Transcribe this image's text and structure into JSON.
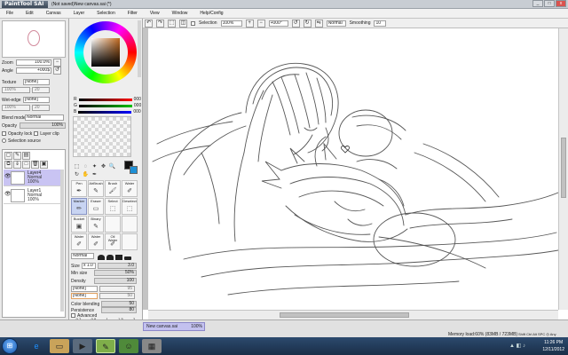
{
  "window": {
    "logo": "PaintTool SAI",
    "title": "(Not saved)New canvas.sai (*)",
    "min": "_",
    "max": "□",
    "close": "x"
  },
  "menu": [
    "File",
    "Edit",
    "Canvas",
    "Layer",
    "Selection",
    "Filter",
    "View",
    "Window",
    "Help/Config"
  ],
  "navigator": {
    "zoom_label": "Zoom",
    "zoom_value": "100.0%",
    "angle_label": "Angle",
    "angle_value": "+000$"
  },
  "texture": {
    "label": "Texture",
    "value": "[None]",
    "scale": "100%",
    "strength": "20"
  },
  "wetedge": {
    "label": "Wet-edge",
    "value": "[None]",
    "scale": "100%",
    "strength": "20"
  },
  "layer_props": {
    "blend_label": "Blend mode",
    "blend_value": "Normal",
    "opacity_label": "Opacity",
    "opacity_value": "100%",
    "opacity_lock": "Opacity lock",
    "layer_clip": "Layer clip",
    "selection_source": "Selection source"
  },
  "layers": [
    {
      "name": "Layer4",
      "mode": "Normal",
      "opacity": "100%"
    },
    {
      "name": "Layer1",
      "mode": "Normal",
      "opacity": "100%"
    }
  ],
  "rgb": {
    "r_label": "R",
    "g_label": "G",
    "b_label": "B",
    "r": "000",
    "g": "000",
    "b": "000"
  },
  "brushes": [
    {
      "label": "Pen",
      "icon": "✒"
    },
    {
      "label": "AirBrush",
      "icon": "✎"
    },
    {
      "label": "Brush",
      "icon": "🖌"
    },
    {
      "label": "Water",
      "icon": "✐"
    },
    {
      "label": "Marker",
      "icon": "✏"
    },
    {
      "label": "Eraser",
      "icon": "▭"
    },
    {
      "label": "Select",
      "icon": "⬚"
    },
    {
      "label": "Deselect",
      "icon": "⬚"
    },
    {
      "label": "Bucket",
      "icon": "▣"
    },
    {
      "label": "Binary",
      "icon": "✎"
    },
    {
      "label": "",
      "icon": ""
    },
    {
      "label": "",
      "icon": ""
    },
    {
      "label": "Water",
      "icon": "✐"
    },
    {
      "label": "Water",
      "icon": "✐"
    },
    {
      "label": "Oil Water",
      "icon": "✐"
    },
    {
      "label": "",
      "icon": ""
    }
  ],
  "brush_settings": {
    "mode": "Normal",
    "size_label": "Size",
    "size_mult": "x 1.0",
    "size_value": "3.0",
    "minsize_label": "Min size",
    "minsize_value": "50%",
    "density_label": "Density",
    "density_value": "100",
    "texture_value": "[None]",
    "texture_strength": "95",
    "wetedge_value": "[None]",
    "wetedge_strength": "50",
    "blending_label": "Color blending",
    "blending_value": "50",
    "persistence_label": "Persistence",
    "persistence_value": "80",
    "advanced_label": "Advanced",
    "size_presets": [
      "0.7",
      "0.8",
      "1",
      "1.5",
      "2"
    ]
  },
  "canvas_toolbar": {
    "selection_label": "Selection",
    "zoom": "100%",
    "angle": "+000°",
    "mode": "Normal",
    "smoothing_label": "Smoothing",
    "smoothing_value": "10"
  },
  "status": {
    "tab": "New canvas.sai",
    "tab_zoom": "100%",
    "memory": "Memory load:60% (83MB / 723MB)",
    "keys": "Shift Ctrl Alt SPC ◎ Any"
  },
  "taskbar": {
    "time": "11:26 PM",
    "date": "12/11/2012"
  },
  "colors": {
    "accent": "#c6c3f2",
    "selected_brush": "#c8d4f2"
  }
}
